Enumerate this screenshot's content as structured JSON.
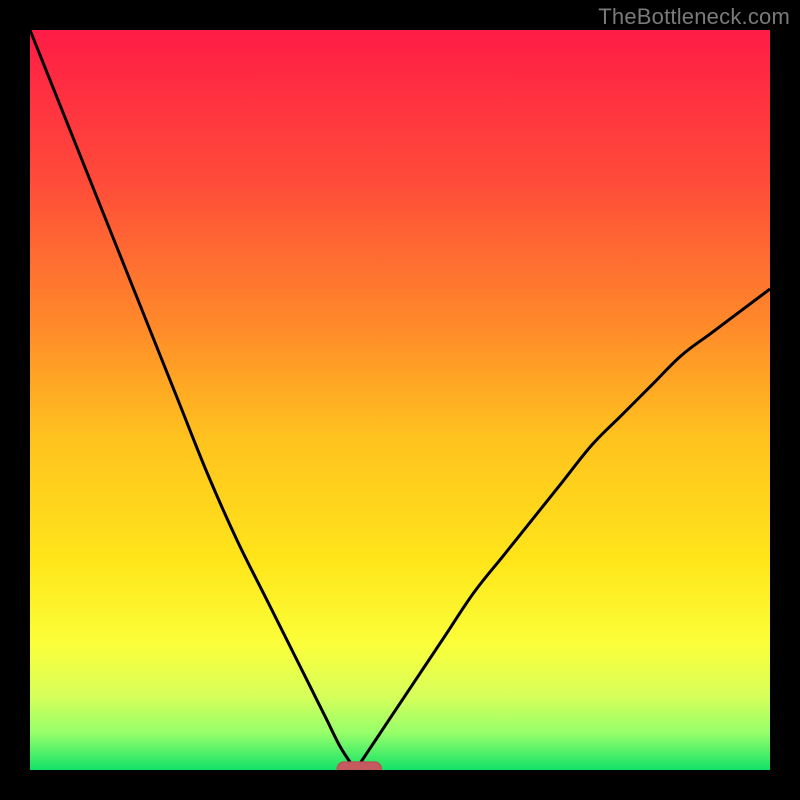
{
  "watermark": "TheBottleneck.com",
  "colors": {
    "gradient_stops": [
      {
        "offset": 0.0,
        "color": "#ff1c46"
      },
      {
        "offset": 0.2,
        "color": "#ff4a3a"
      },
      {
        "offset": 0.4,
        "color": "#ff8a2a"
      },
      {
        "offset": 0.55,
        "color": "#ffc21e"
      },
      {
        "offset": 0.72,
        "color": "#ffe61a"
      },
      {
        "offset": 0.83,
        "color": "#fbff3a"
      },
      {
        "offset": 0.9,
        "color": "#d7ff5a"
      },
      {
        "offset": 0.95,
        "color": "#96ff6a"
      },
      {
        "offset": 1.0,
        "color": "#12e268"
      }
    ],
    "curve": "#000000",
    "marker_fill": "#c55a5f",
    "marker_stroke": "#b94c52",
    "frame": "#000000"
  },
  "chart_data": {
    "type": "line",
    "title": "",
    "xlabel": "",
    "ylabel": "",
    "xlim": [
      0,
      100
    ],
    "ylim": [
      0,
      100
    ],
    "optimum_x": 44,
    "marker": {
      "x_start": 41.5,
      "x_end": 47.5,
      "y": 0,
      "thickness": 2.2
    },
    "series": [
      {
        "name": "left-branch",
        "x": [
          0,
          4,
          8,
          12,
          16,
          20,
          24,
          28,
          32,
          36,
          38,
          40,
          42,
          44
        ],
        "y": [
          100,
          90,
          80,
          70,
          60,
          50,
          40,
          31,
          23,
          15,
          11,
          7,
          3,
          0
        ]
      },
      {
        "name": "right-branch",
        "x": [
          44,
          46,
          48,
          52,
          56,
          60,
          64,
          68,
          72,
          76,
          80,
          84,
          88,
          92,
          96,
          100
        ],
        "y": [
          0,
          3,
          6,
          12,
          18,
          24,
          29,
          34,
          39,
          44,
          48,
          52,
          56,
          59,
          62,
          65
        ]
      }
    ]
  }
}
